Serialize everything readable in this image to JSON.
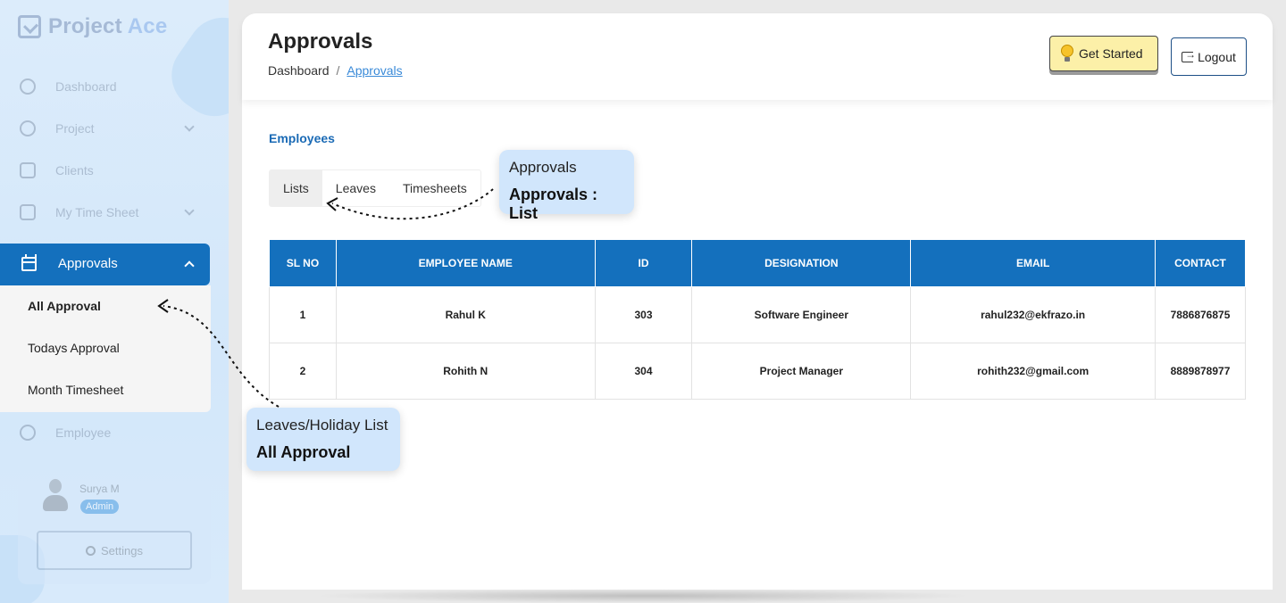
{
  "brand": {
    "name_part1": "Project",
    "name_part2": "Ace"
  },
  "sidebar": {
    "items": [
      {
        "label": "Dashboard",
        "icon": "dashboard-icon"
      },
      {
        "label": "Project",
        "icon": "project-icon"
      },
      {
        "label": "Clients",
        "icon": "clients-icon"
      },
      {
        "label": "My Time Sheet",
        "icon": "timesheet-icon"
      },
      {
        "label": "Approvals",
        "icon": "calendar-icon"
      },
      {
        "label": "Employee",
        "icon": "employee-icon"
      }
    ],
    "submenu": [
      "All Approval",
      "Todays Approval",
      "Month Timesheet"
    ],
    "user": {
      "name": "Surya M",
      "role": "Admin"
    },
    "settings_label": "Settings"
  },
  "header": {
    "title": "Approvals",
    "breadcrumb": {
      "home": "Dashboard",
      "separator": "/",
      "current": "Approvals"
    },
    "get_started": "Get Started",
    "logout": "Logout"
  },
  "main": {
    "section_title": "Employees",
    "tabs": [
      "Lists",
      "Leaves",
      "Timesheets"
    ],
    "table": {
      "headers": [
        "SL NO",
        "EMPLOYEE NAME",
        "ID",
        "DESIGNATION",
        "EMAIL",
        "CONTACT"
      ],
      "rows": [
        [
          "1",
          "Rahul K",
          "303",
          "Software Engineer",
          "rahul232@ekfrazo.in",
          "7886876875"
        ],
        [
          "2",
          "Rohith N",
          "304",
          "Project Manager",
          "rohith232@gmail.com",
          "8889878977"
        ]
      ]
    }
  },
  "callouts": {
    "tabs": {
      "line1": "Approvals",
      "line2": "Approvals : List"
    },
    "submenu": {
      "line1": "Leaves/Holiday List",
      "line2": "All Approval"
    }
  },
  "colors": {
    "primary": "#1470bd",
    "accent_yellow": "#fcf0a8",
    "callout_bg": "#d1e6fc"
  }
}
